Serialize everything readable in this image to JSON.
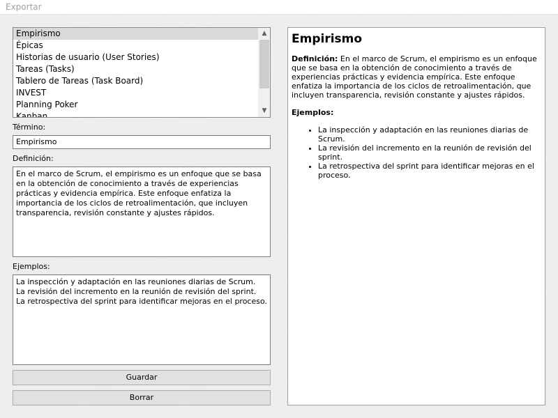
{
  "menu": {
    "export_label": "Exportar"
  },
  "terms_list": {
    "items": [
      "Empirismo",
      "Épicas",
      "Historias de usuario (User Stories)",
      "Tareas (Tasks)",
      "Tablero de Tareas (Task Board)",
      "INVEST",
      "Planning Poker",
      "Kanban"
    ],
    "selected_index": 0
  },
  "form": {
    "term_label": "Término:",
    "term_value": "Empirismo",
    "definition_label": "Definición:",
    "definition_value": "En el marco de Scrum, el empirismo es un enfoque que se basa en la obtención de conocimiento a través de experiencias prácticas y evidencia empírica. Este enfoque enfatiza la importancia de los ciclos de retroalimentación, que incluyen transparencia, revisión constante y ajustes rápidos.",
    "examples_label": "Ejemplos:",
    "examples_value": "La inspección y adaptación en las reuniones diarias de Scrum.\nLa revisión del incremento en la reunión de revisión del sprint.\nLa retrospectiva del sprint para identificar mejoras en el proceso.",
    "save_label": "Guardar",
    "delete_label": "Borrar"
  },
  "preview": {
    "title": "Empirismo",
    "definition_heading": "Definición:",
    "definition_text": " En el marco de Scrum, el empirismo es un enfoque que se basa en la obtención de conocimiento a través de experiencias prácticas y evidencia empírica. Este enfoque enfatiza la importancia de los ciclos de retroalimentación, que incluyen transparencia, revisión constante y ajustes rápidos.",
    "examples_heading": "Ejemplos:",
    "examples": [
      "La inspección y adaptación en las reuniones diarias de Scrum.",
      "La revisión del incremento en la reunión de revisión del sprint.",
      "La retrospectiva del sprint para identificar mejoras en el proceso."
    ]
  }
}
